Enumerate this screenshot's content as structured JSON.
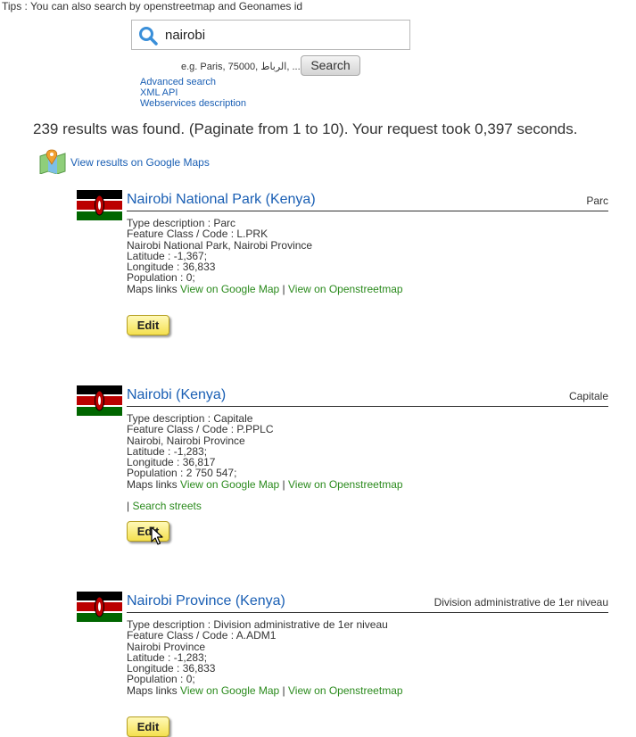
{
  "tips": "Tips : You can also search by openstreetmap and Geonames id",
  "search": {
    "value": "nairobi",
    "example": "e.g. Paris, 75000, الرباط, ...",
    "button_label": "Search"
  },
  "links": {
    "advanced": "Advanced search",
    "xml": "XML API",
    "webservices": "Webservices description"
  },
  "summary": "239 results was found. (Paginate from 1 to 10). Your request took 0,397 seconds.",
  "google_maps_link": "View results on Google Maps",
  "results": [
    {
      "title": "Nairobi National Park (Kenya)",
      "type": "Parc",
      "type_description": "Type description : Parc",
      "feature": "Feature Class / Code : L.PRK",
      "location": "Nairobi National Park, Nairobi Province",
      "latitude": "Latitude : -1,367;",
      "longitude": "Longitude : 36,833",
      "population": "Population : 0;",
      "maps_prefix": "Maps links ",
      "google_link": "View on Google Map",
      "separator": " | ",
      "osm_link": "View on Openstreetmap",
      "edit_label": "Edit"
    },
    {
      "title": "Nairobi (Kenya)",
      "type": "Capitale",
      "type_description": "Type description : Capitale",
      "feature": "Feature Class / Code : P.PPLC",
      "location": "Nairobi, Nairobi Province",
      "latitude": "Latitude : -1,283;",
      "longitude": "Longitude : 36,817",
      "population": "Population : 2 750 547;",
      "maps_prefix": "Maps links ",
      "google_link": "View on Google Map",
      "separator": " | ",
      "osm_link": "View on Openstreetmap",
      "streets_prefix": "| ",
      "streets_link": "Search streets",
      "edit_label": "Edit"
    },
    {
      "title": "Nairobi Province (Kenya)",
      "type": "Division administrative de 1er niveau",
      "type_description": "Type description : Division administrative de 1er niveau",
      "feature": "Feature Class / Code : A.ADM1",
      "location": "Nairobi Province",
      "latitude": "Latitude : -1,283;",
      "longitude": "Longitude : 36,833",
      "population": "Population : 0;",
      "maps_prefix": "Maps links ",
      "google_link": "View on Google Map",
      "separator": " | ",
      "osm_link": "View on Openstreetmap",
      "edit_label": "Edit"
    }
  ],
  "colors": {
    "link_blue": "#1a5fb4",
    "link_green": "#2a8a1c",
    "edit_yellow": "#f4e04f",
    "flag_red": "#bb0000",
    "flag_green": "#006600"
  },
  "icons": [
    "search-icon",
    "google-maps-icon",
    "kenya-flag-icon",
    "mouse-cursor-icon"
  ]
}
